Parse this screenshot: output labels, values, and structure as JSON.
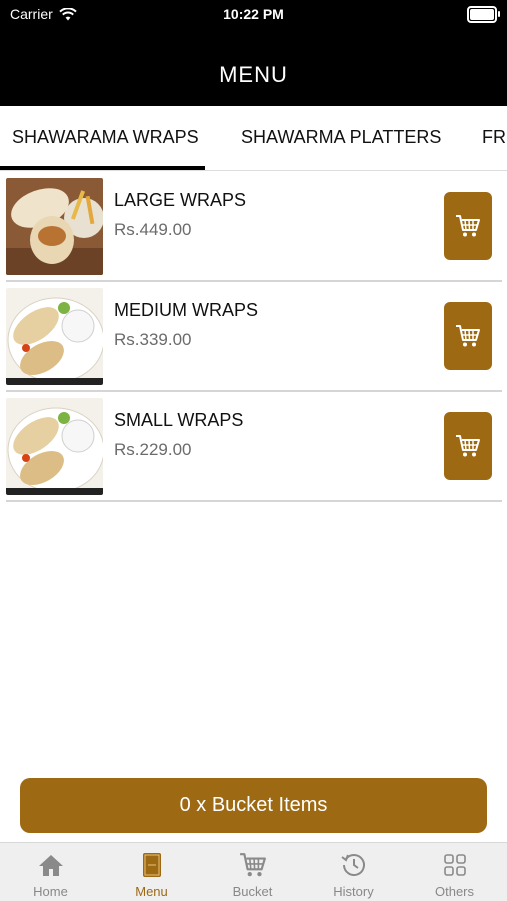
{
  "status": {
    "carrier": "Carrier",
    "time": "10:22 PM"
  },
  "header": {
    "title": "MENU"
  },
  "tabs": [
    {
      "label": "SHAWARAMA WRAPS",
      "active": true
    },
    {
      "label": "SHAWARMA PLATTERS",
      "active": false
    },
    {
      "label": "FR",
      "active": false
    }
  ],
  "items": [
    {
      "name": "LARGE WRAPS",
      "price": "Rs.449.00"
    },
    {
      "name": "MEDIUM WRAPS",
      "price": "Rs.339.00"
    },
    {
      "name": "SMALL WRAPS",
      "price": "Rs.229.00"
    }
  ],
  "bucket": {
    "label": "0 x Bucket Items"
  },
  "tabbar": [
    {
      "label": "Home",
      "icon": "home-icon"
    },
    {
      "label": "Menu",
      "icon": "menu-book-icon",
      "active": true
    },
    {
      "label": "Bucket",
      "icon": "cart-icon"
    },
    {
      "label": "History",
      "icon": "history-icon"
    },
    {
      "label": "Others",
      "icon": "grid-icon"
    }
  ],
  "colors": {
    "accent": "#9d6913",
    "header_bg": "#000000"
  }
}
